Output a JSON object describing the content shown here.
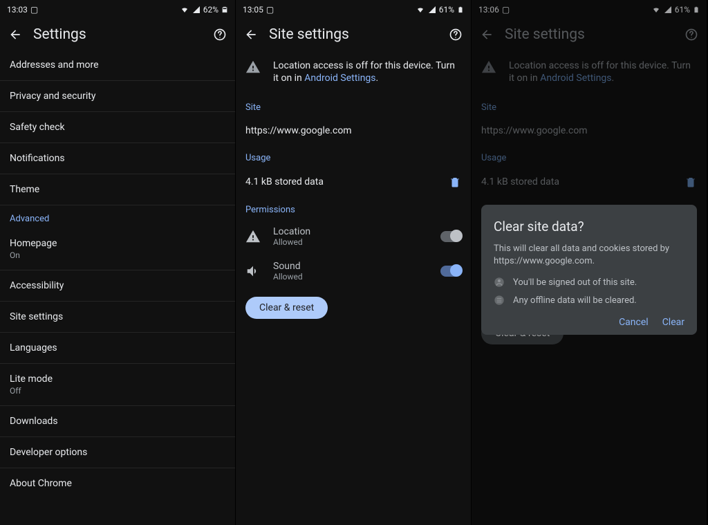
{
  "panel1": {
    "status": {
      "time": "13:03",
      "battery": "62%"
    },
    "title": "Settings",
    "items": [
      {
        "label": "Addresses and more",
        "sub": ""
      },
      {
        "label": "Privacy and security",
        "sub": ""
      },
      {
        "label": "Safety check",
        "sub": ""
      },
      {
        "label": "Notifications",
        "sub": ""
      },
      {
        "label": "Theme",
        "sub": ""
      }
    ],
    "advanced_label": "Advanced",
    "advanced_items": [
      {
        "label": "Homepage",
        "sub": "On"
      },
      {
        "label": "Accessibility",
        "sub": ""
      },
      {
        "label": "Site settings",
        "sub": ""
      },
      {
        "label": "Languages",
        "sub": ""
      },
      {
        "label": "Lite mode",
        "sub": "Off"
      },
      {
        "label": "Downloads",
        "sub": ""
      },
      {
        "label": "Developer options",
        "sub": ""
      },
      {
        "label": "About Chrome",
        "sub": ""
      }
    ]
  },
  "panel2": {
    "status": {
      "time": "13:05",
      "battery": "61%"
    },
    "title": "Site settings",
    "location_note_prefix": "Location access is off for this device. Turn it on in ",
    "location_note_link": "Android Settings",
    "location_note_suffix": ".",
    "site_label": "Site",
    "site_url": "https://www.google.com",
    "usage_label": "Usage",
    "usage_value": "4.1 kB stored data",
    "permissions_label": "Permissions",
    "perm_location": {
      "name": "Location",
      "status": "Allowed"
    },
    "perm_sound": {
      "name": "Sound",
      "status": "Allowed"
    },
    "clear_btn": "Clear & reset"
  },
  "panel3": {
    "status": {
      "time": "13:06",
      "battery": "61%"
    },
    "title": "Site settings",
    "location_note_prefix": "Location access is off for this device. Turn it on in ",
    "location_note_link": "Android Settings",
    "location_note_suffix": ".",
    "site_label": "Site",
    "site_url": "https://www.google.com",
    "usage_label": "Usage",
    "usage_value": "4.1 kB stored data",
    "clear_btn": "Clear & reset",
    "dialog": {
      "title": "Clear site data?",
      "body": "This will clear all data and cookies stored by https://www.google.com.",
      "bullet1": "You'll be signed out of this site.",
      "bullet2": "Any offline data will be cleared.",
      "cancel": "Cancel",
      "clear": "Clear"
    }
  }
}
